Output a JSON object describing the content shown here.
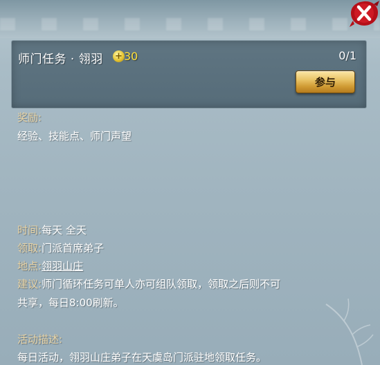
{
  "dialog": {
    "close_icon": "close-x-icon",
    "title": "师门任务 · 翎羽",
    "level_icon": "plus-coin-icon",
    "level_icon_glyph": "+",
    "level_value": "30",
    "progress": "0/1",
    "join_label": "参与"
  },
  "reward": {
    "label": "奖励:",
    "value": "经验、技能点、师门声望"
  },
  "info": {
    "time_label": "时间:",
    "time_value": "每天 全天",
    "receive_label": "领取:",
    "receive_value": "门派首席弟子",
    "place_label": "地点:",
    "place_value": "翎羽山庄",
    "advice_label": "建议:",
    "advice_line1": "师门循环任务可单人亦可组队领取，领取之后则不可",
    "advice_line2": "共享，每日8:00刷新。"
  },
  "activity": {
    "label": "活动描述:",
    "value": "每日活动，翎羽山庄弟子在天虞岛门派驻地领取任务。"
  },
  "colors": {
    "label_color": "#e7d3a6",
    "level_color": "#ffe03a",
    "close_red": "#c2121a"
  }
}
